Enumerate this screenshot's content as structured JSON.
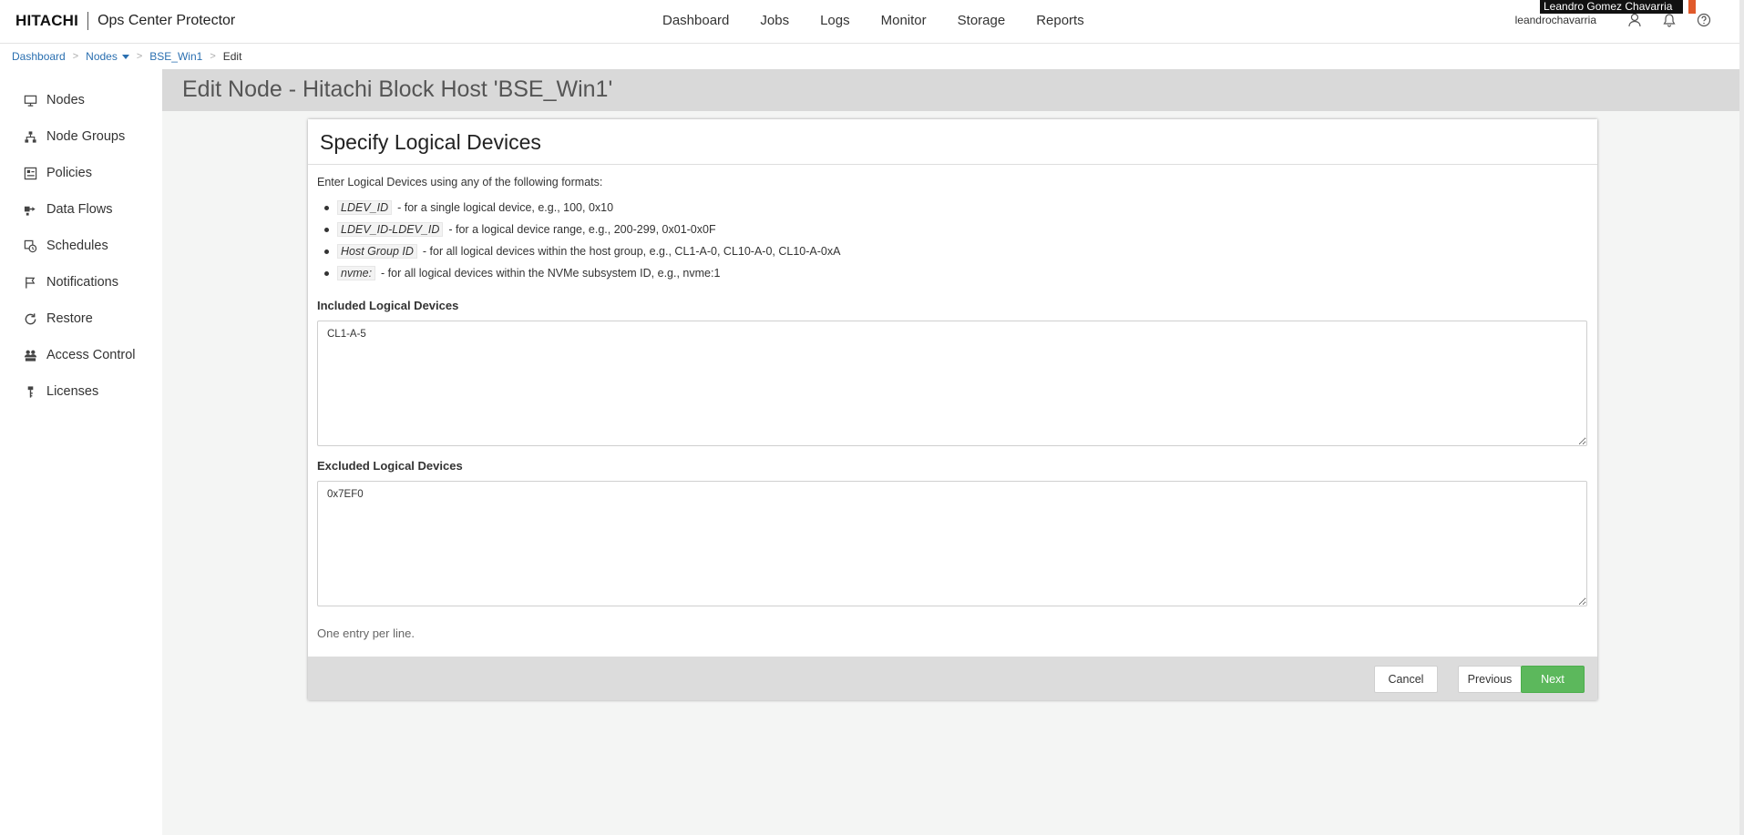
{
  "brand": {
    "logo": "HITACHI",
    "product": "Ops Center Protector"
  },
  "nav": [
    "Dashboard",
    "Jobs",
    "Logs",
    "Monitor",
    "Storage",
    "Reports"
  ],
  "user": {
    "name": "leandrochavarria",
    "tooltip": "Leandro Gomez Chavarria"
  },
  "icons": {
    "user": "user-icon",
    "bell": "bell-icon",
    "help": "help-icon"
  },
  "breadcrumb": {
    "home": "Dashboard",
    "nodes": "Nodes",
    "node": "BSE_Win1",
    "current": "Edit"
  },
  "sidebar": [
    {
      "label": "Nodes",
      "icon": "monitor-icon"
    },
    {
      "label": "Node Groups",
      "icon": "hierarchy-icon"
    },
    {
      "label": "Policies",
      "icon": "policy-icon"
    },
    {
      "label": "Data Flows",
      "icon": "dataflow-icon"
    },
    {
      "label": "Schedules",
      "icon": "schedule-icon"
    },
    {
      "label": "Notifications",
      "icon": "flag-icon"
    },
    {
      "label": "Restore",
      "icon": "restore-icon"
    },
    {
      "label": "Access Control",
      "icon": "users-icon"
    },
    {
      "label": "Licenses",
      "icon": "license-icon"
    }
  ],
  "page": {
    "title": "Edit Node - Hitachi Block Host 'BSE_Win1'"
  },
  "panel": {
    "title": "Specify Logical Devices",
    "intro": "Enter Logical Devices using any of the following formats:",
    "formats": [
      {
        "code": "LDEV_ID",
        "text": "- for a single logical device, e.g., 100, 0x10"
      },
      {
        "code": "LDEV_ID-LDEV_ID",
        "text": "- for a logical device range, e.g., 200-299, 0x01-0x0F"
      },
      {
        "code": "Host Group ID",
        "text": "- for all logical devices within the host group, e.g., CL1-A-0, CL10-A-0, CL10-A-0xA"
      },
      {
        "code": "nvme:",
        "text": "- for all logical devices within the NVMe subsystem ID, e.g., nvme:1"
      }
    ],
    "included_label": "Included Logical Devices",
    "included_value": "CL1-A-5",
    "excluded_label": "Excluded Logical Devices",
    "excluded_value": "0x7EF0",
    "hint": "One entry per line.",
    "buttons": {
      "cancel": "Cancel",
      "previous": "Previous",
      "next": "Next"
    }
  },
  "colors": {
    "accent_link": "#2a6fb0",
    "next_button": "#5cb85c",
    "header_band": "#d9d9d9"
  }
}
